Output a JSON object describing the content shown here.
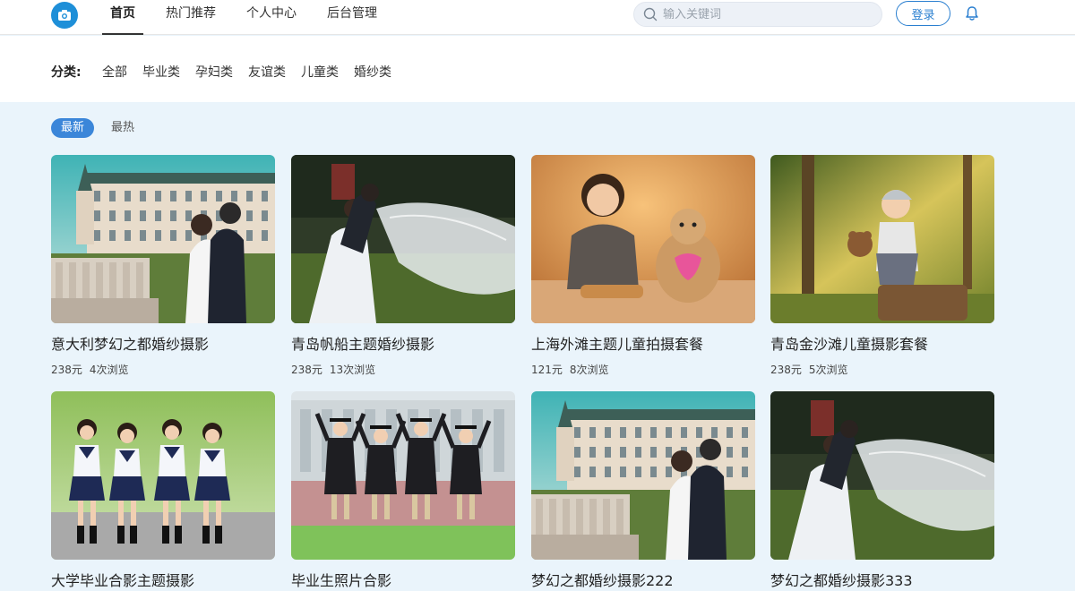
{
  "header": {
    "nav": [
      {
        "label": "首页",
        "active": true
      },
      {
        "label": "热门推荐",
        "active": false
      },
      {
        "label": "个人中心",
        "active": false
      },
      {
        "label": "后台管理",
        "active": false
      }
    ],
    "search_placeholder": "输入关键词",
    "login_label": "登录",
    "icons": {
      "logo": "camera-icon",
      "search": "search-icon",
      "bell": "bell-icon"
    },
    "colors": {
      "accent": "#2a7fd0",
      "logo_bg": "#1e8fd8"
    }
  },
  "categories": {
    "label": "分类:",
    "items": [
      "全部",
      "毕业类",
      "孕妇类",
      "友谊类",
      "儿童类",
      "婚纱类"
    ]
  },
  "sort": {
    "options": [
      {
        "label": "最新",
        "active": true
      },
      {
        "label": "最热",
        "active": false
      }
    ]
  },
  "cards": [
    {
      "title": "意大利梦幻之都婚纱摄影",
      "price": "238元",
      "views": "4次浏览",
      "scene": "castle"
    },
    {
      "title": "青岛帆船主题婚纱摄影",
      "price": "238元",
      "views": "13次浏览",
      "scene": "veil"
    },
    {
      "title": "上海外滩主题儿童拍摄套餐",
      "price": "121元",
      "views": "8次浏览",
      "scene": "child-warm"
    },
    {
      "title": "青岛金沙滩儿童摄影套餐",
      "price": "238元",
      "views": "5次浏览",
      "scene": "child-forest"
    },
    {
      "title": "大学毕业合影主题摄影",
      "price": "",
      "views": "",
      "scene": "students"
    },
    {
      "title": "毕业生照片合影",
      "price": "",
      "views": "",
      "scene": "jump"
    },
    {
      "title": "梦幻之都婚纱摄影222",
      "price": "",
      "views": "",
      "scene": "castle"
    },
    {
      "title": "梦幻之都婚纱摄影333",
      "price": "",
      "views": "",
      "scene": "veil"
    }
  ]
}
